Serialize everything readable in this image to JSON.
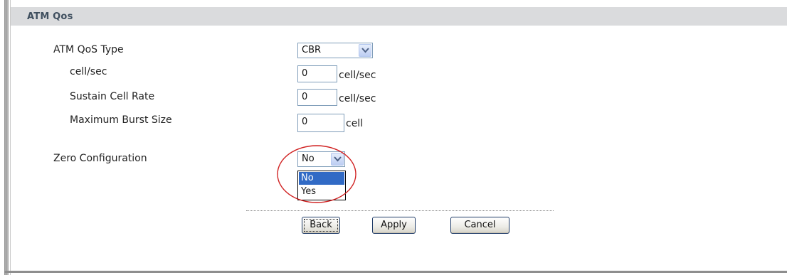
{
  "section": {
    "title": "ATM Qos"
  },
  "fields": {
    "qos_type": {
      "label": "ATM QoS Type",
      "value": "CBR"
    },
    "cell_rate": {
      "label": "cell/sec",
      "value": "0",
      "unit": "cell/sec"
    },
    "sustain_cell_rate": {
      "label": "Sustain Cell Rate",
      "value": "0",
      "unit": "cell/sec"
    },
    "max_burst_size": {
      "label": "Maximum Burst Size",
      "value": "0",
      "unit": "cell"
    },
    "zero_configuration": {
      "label": "Zero Configuration",
      "value": "No",
      "options": [
        "No",
        "Yes"
      ],
      "selected_option": "No"
    }
  },
  "buttons": {
    "back": "Back",
    "apply": "Apply",
    "cancel": "Cancel"
  },
  "colors": {
    "header_bg": "#dadbdd",
    "header_text": "#3f4f5f",
    "selected_option_bg": "#316ac5",
    "highlight_ellipse": "#d02020"
  },
  "icons": {
    "dropdown_arrow": "chevron-down-icon"
  }
}
